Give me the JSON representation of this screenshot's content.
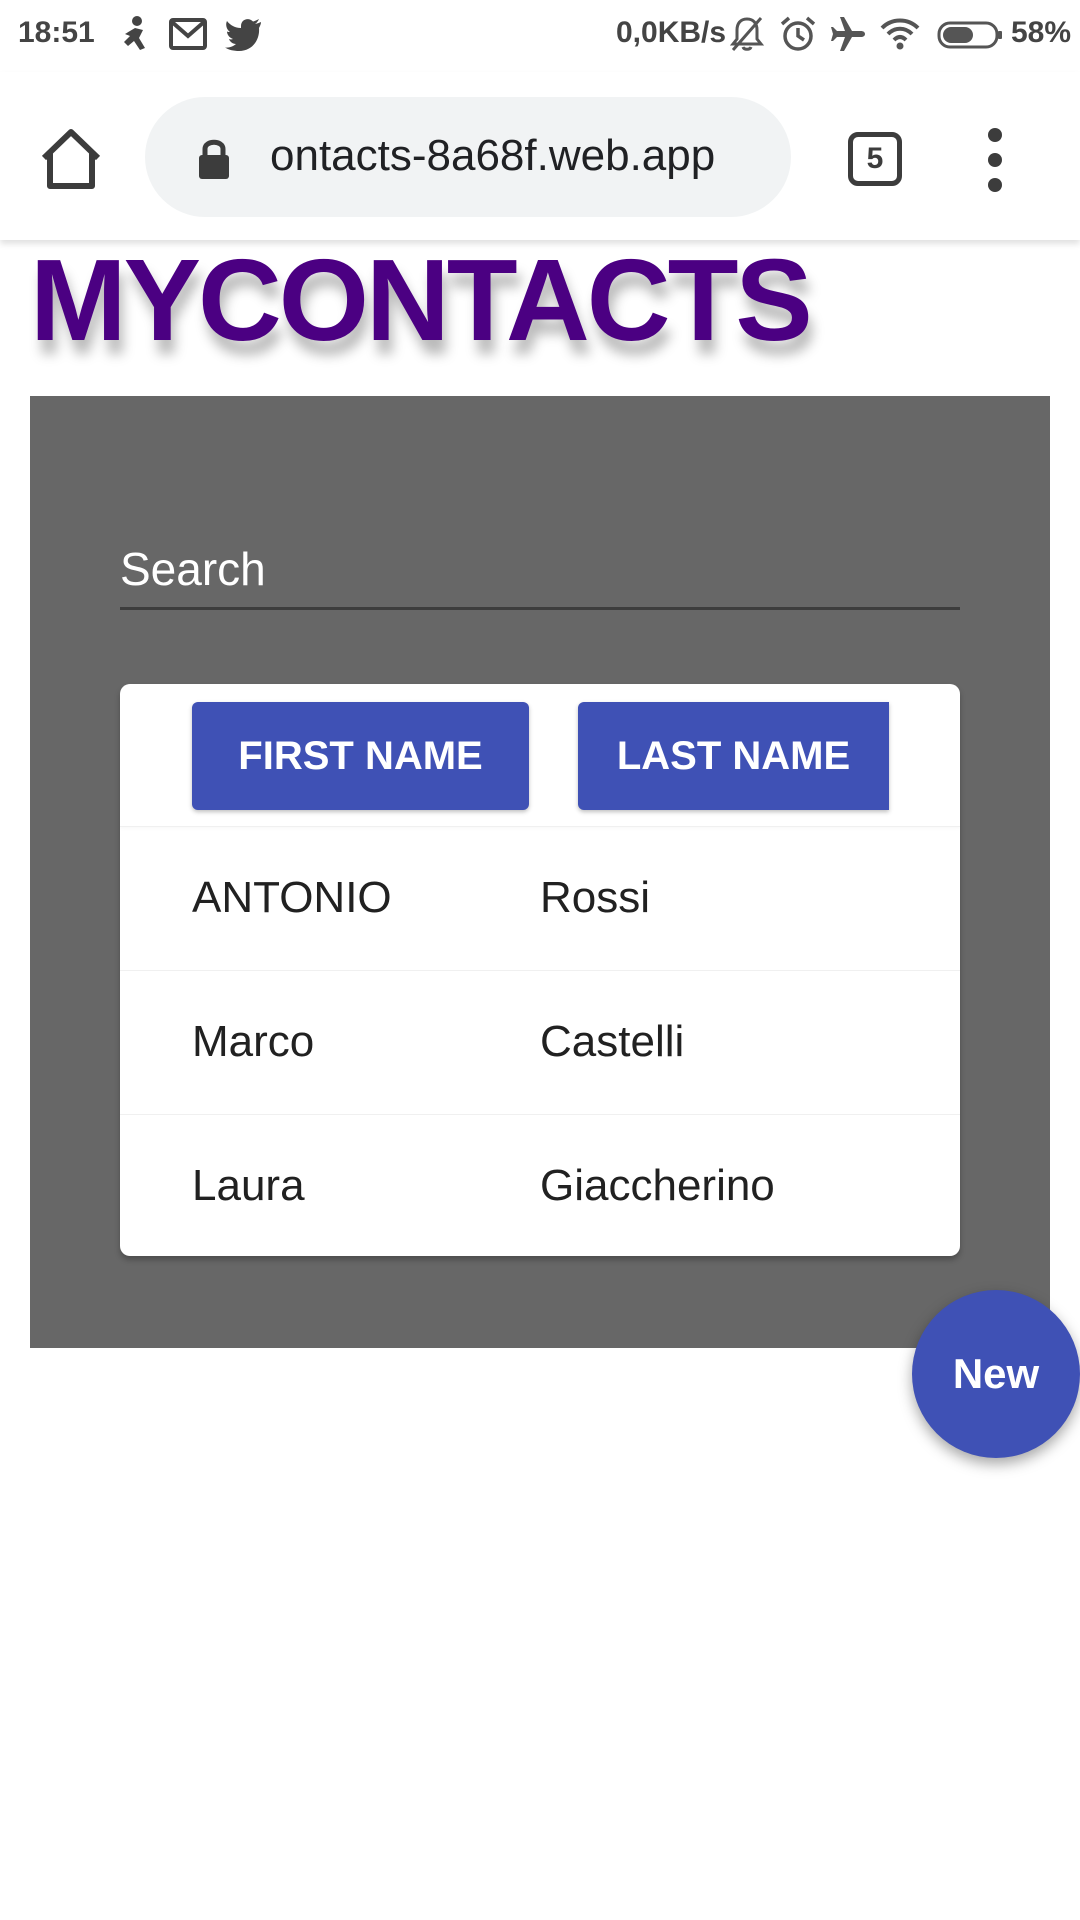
{
  "status_bar": {
    "time": "18:51",
    "notification_icons": [
      "accessibility-icon",
      "gmail-icon",
      "twitter-icon"
    ],
    "network_speed": "0,0KB/s",
    "system_icons": [
      "silent-icon",
      "alarm-icon",
      "airplane-icon",
      "wifi-icon",
      "battery-icon"
    ],
    "battery": "58%"
  },
  "browser": {
    "url": "ontacts-8a68f.web.app",
    "tab_count": "5",
    "icons": [
      "home-icon",
      "lock-icon",
      "tabs-icon",
      "more-vert-icon"
    ]
  },
  "page": {
    "title": "MYCONTACTS",
    "search_placeholder": "Search",
    "columns": {
      "first_name": "FIRST NAME",
      "last_name": "LAST NAME"
    },
    "contacts": [
      {
        "first": "ANTONIO",
        "last": "Rossi"
      },
      {
        "first": "Marco",
        "last": "Castelli"
      },
      {
        "first": "Laura",
        "last": "Giaccherino"
      }
    ],
    "new_button": "New"
  },
  "colors": {
    "title": "#4b0082",
    "panel_background": "#676767",
    "accent": "#3f51b5"
  }
}
